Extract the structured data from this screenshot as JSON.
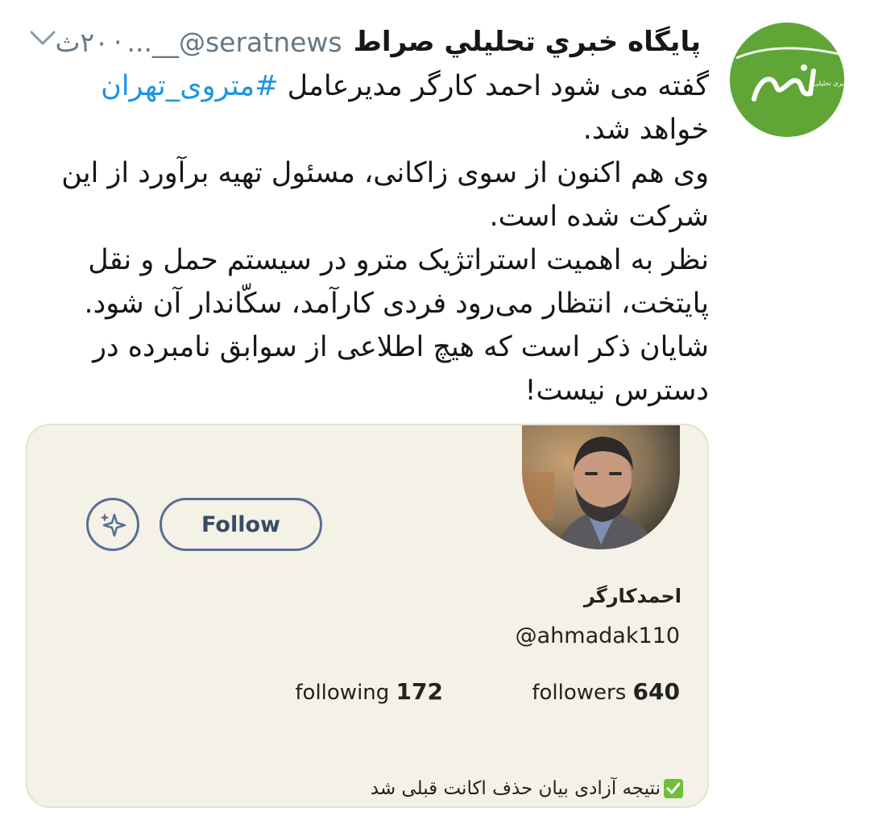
{
  "tweet": {
    "author_name": "پايگاه خبري تحليلي صراط",
    "author_handle": "...__@seratnews",
    "separator": "·",
    "time": "۲۰ث",
    "text_lines": {
      "l1_before": "گفته می شود احمد کارگر مدیرعامل",
      "l1_hashtag": "#متروی_تهران",
      "l2": "خواهد شد.",
      "l3": "وی هم اکنون از سوی زاکانی، مسئول تهیه برآورد از این",
      "l4": "شرکت شده است.",
      "l5": "نظر به اهمیت استراتژیک مترو در سیستم حمل و نقل",
      "l6": "پایتخت، انتظار می‌رود فردی کارآمد، سکّاندار آن شود.",
      "l7": "شایان ذکر است که هیچ اطلاعی از سوابق نامبرده در",
      "l8": "دسترس نیست!"
    },
    "avatar_logo_text": "صراط",
    "avatar_logo_sub": "پایگاه خبری تحلیلی"
  },
  "profile_card": {
    "follow_label": "Follow",
    "display_name": "احمدکارگر",
    "username": "@ahmadak110",
    "followers_label": "followers",
    "followers_count": "640",
    "following_label": "following",
    "following_count": "172",
    "bio": "نتیجه آزادی بیان حذف اکانت قبلی شد"
  },
  "colors": {
    "avatar_green": "#5fa637",
    "hashtag_blue": "#1b95e0",
    "card_bg": "#f4f1e7",
    "button_outline": "#5a6e93"
  },
  "icons": [
    "chevron-down-icon",
    "sparkle-icon",
    "checkmark-icon"
  ]
}
